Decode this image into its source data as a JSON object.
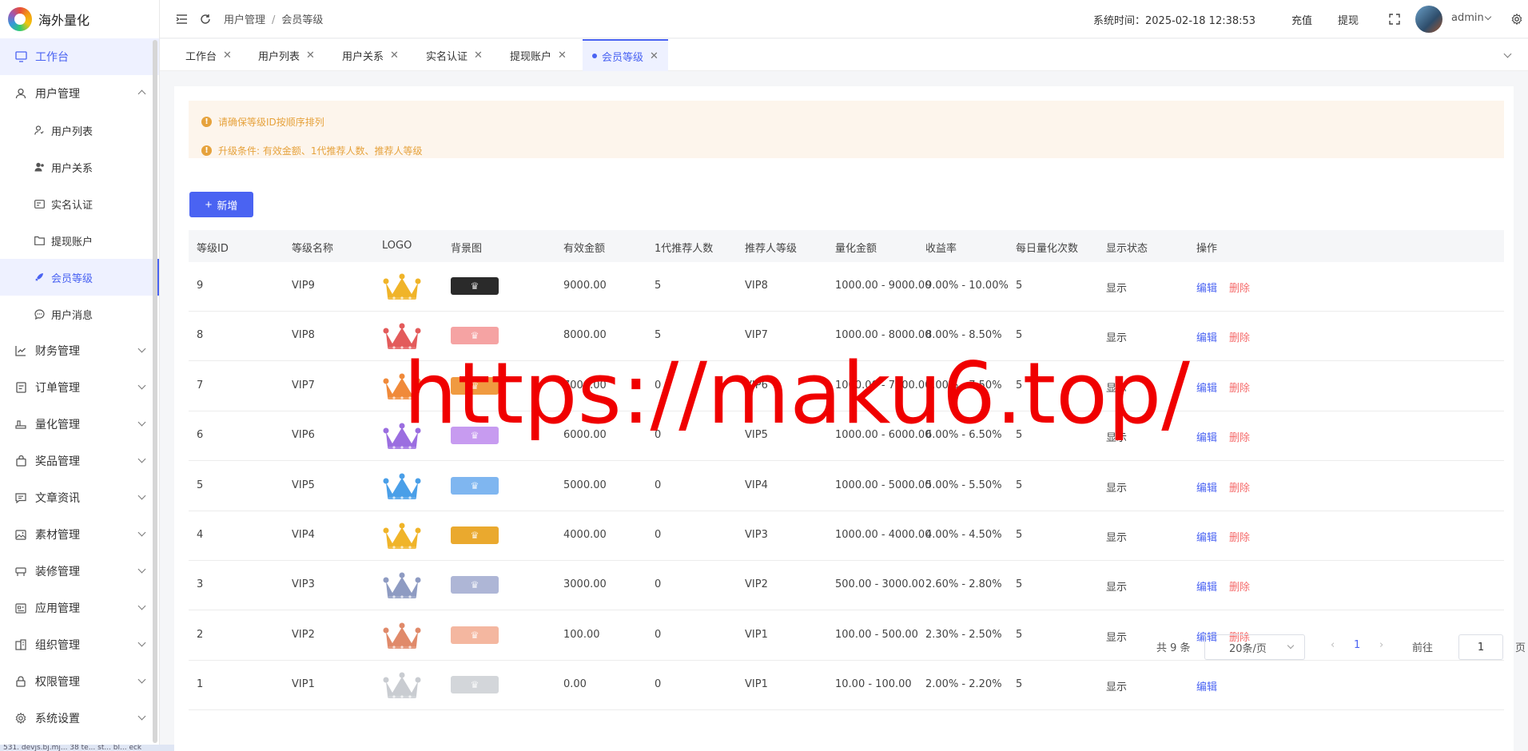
{
  "app": {
    "name": "海外量化"
  },
  "sidebar": {
    "workspace": "工作台",
    "user_mgmt": "用户管理",
    "sub": [
      {
        "label": "用户列表",
        "icon": "user-icon"
      },
      {
        "label": "用户关系",
        "icon": "users-icon"
      },
      {
        "label": "实名认证",
        "icon": "id-card-icon"
      },
      {
        "label": "提现账户",
        "icon": "folder-icon"
      },
      {
        "label": "会员等级",
        "icon": "rocket-icon"
      },
      {
        "label": "用户消息",
        "icon": "chat-icon"
      }
    ],
    "groups": [
      {
        "label": "财务管理",
        "icon": "chart-icon"
      },
      {
        "label": "订单管理",
        "icon": "order-icon"
      },
      {
        "label": "量化管理",
        "icon": "quant-icon"
      },
      {
        "label": "奖品管理",
        "icon": "bag-icon"
      },
      {
        "label": "文章资讯",
        "icon": "message-icon"
      },
      {
        "label": "素材管理",
        "icon": "image-icon"
      },
      {
        "label": "装修管理",
        "icon": "decor-icon"
      },
      {
        "label": "应用管理",
        "icon": "app-icon"
      },
      {
        "label": "组织管理",
        "icon": "org-icon"
      },
      {
        "label": "权限管理",
        "icon": "lock-icon"
      },
      {
        "label": "系统设置",
        "icon": "gear-icon"
      }
    ],
    "bottom_text": "531. devjs.bj.mj... 38 te... st... bl... eck"
  },
  "header": {
    "breadcrumb": [
      "用户管理",
      "会员等级"
    ],
    "system_time": "系统时间：2025-02-18 12:38:53",
    "recharge": "充值",
    "withdraw": "提现",
    "user": "admin"
  },
  "tabs": [
    "工作台",
    "用户列表",
    "用户关系",
    "实名认证",
    "提现账户",
    "会员等级"
  ],
  "alerts": [
    "请确保等级ID按顺序排列",
    "升级条件: 有效金额、1代推荐人数、推荐人等级"
  ],
  "add_button": "新增",
  "table": {
    "headers": [
      "等级ID",
      "等级名称",
      "LOGO",
      "背景图",
      "有效金额",
      "1代推荐人数",
      "推荐人等级",
      "量化金额",
      "收益率",
      "每日量化次数",
      "显示状态",
      "操作"
    ],
    "rows": [
      {
        "id": "9",
        "name": "VIP9",
        "amount": "9000.00",
        "refs": "5",
        "ref_level": "VIP8",
        "quant": "1000.00 - 9000.00",
        "rate": "9.00% - 10.00%",
        "daily": "5",
        "status": "显示",
        "edit": "编辑",
        "del": "删除",
        "crown_color": "#f0b429",
        "bg_color": "#2a2a2a"
      },
      {
        "id": "8",
        "name": "VIP8",
        "amount": "8000.00",
        "refs": "5",
        "ref_level": "VIP7",
        "quant": "1000.00 - 8000.00",
        "rate": "8.00% - 8.50%",
        "daily": "5",
        "status": "显示",
        "edit": "编辑",
        "del": "删除",
        "crown_color": "#e35b5b",
        "bg_color": "#f5a3a3"
      },
      {
        "id": "7",
        "name": "VIP7",
        "amount": "7000.00",
        "refs": "0",
        "ref_level": "VIP6",
        "quant": "1000.00 - 7000.00",
        "rate": "7.00% - 7.50%",
        "daily": "5",
        "status": "显示",
        "edit": "编辑",
        "del": "删除",
        "crown_color": "#f08a3a",
        "bg_color": "#f09a40"
      },
      {
        "id": "6",
        "name": "VIP6",
        "amount": "6000.00",
        "refs": "0",
        "ref_level": "VIP5",
        "quant": "1000.00 - 6000.00",
        "rate": "6.00% - 6.50%",
        "daily": "5",
        "status": "显示",
        "edit": "编辑",
        "del": "删除",
        "crown_color": "#9b6ee0",
        "bg_color": "#c79bf0"
      },
      {
        "id": "5",
        "name": "VIP5",
        "amount": "5000.00",
        "refs": "0",
        "ref_level": "VIP4",
        "quant": "1000.00 - 5000.00",
        "rate": "5.00% - 5.50%",
        "daily": "5",
        "status": "显示",
        "edit": "编辑",
        "del": "删除",
        "crown_color": "#4a9fe8",
        "bg_color": "#7fb6f0"
      },
      {
        "id": "4",
        "name": "VIP4",
        "amount": "4000.00",
        "refs": "0",
        "ref_level": "VIP3",
        "quant": "1000.00 - 4000.00",
        "rate": "4.00% - 4.50%",
        "daily": "5",
        "status": "显示",
        "edit": "编辑",
        "del": "删除",
        "crown_color": "#f0b429",
        "bg_color": "#eaa92e"
      },
      {
        "id": "3",
        "name": "VIP3",
        "amount": "3000.00",
        "refs": "0",
        "ref_level": "VIP2",
        "quant": "500.00 - 3000.00",
        "rate": "2.60% - 2.80%",
        "daily": "5",
        "status": "显示",
        "edit": "编辑",
        "del": "删除",
        "crown_color": "#8e9bc2",
        "bg_color": "#aeb6d6"
      },
      {
        "id": "2",
        "name": "VIP2",
        "amount": "100.00",
        "refs": "0",
        "ref_level": "VIP1",
        "quant": "100.00 - 500.00",
        "rate": "2.30% - 2.50%",
        "daily": "5",
        "status": "显示",
        "edit": "编辑",
        "del": "删除",
        "crown_color": "#e08a6a",
        "bg_color": "#f4b7a0"
      },
      {
        "id": "1",
        "name": "VIP1",
        "amount": "0.00",
        "refs": "0",
        "ref_level": "VIP1",
        "quant": "10.00 - 100.00",
        "rate": "2.00% - 2.20%",
        "daily": "5",
        "status": "显示",
        "edit": "编辑",
        "del": "",
        "crown_color": "#c9ccd1",
        "bg_color": "#d3d6da"
      }
    ]
  },
  "pagination": {
    "total": "共 9 条",
    "page_size": "20条/页",
    "current": "1",
    "goto_label": "前往",
    "goto_value": "1",
    "page_unit": "页"
  },
  "watermark": "https://maku6.top/",
  "colors": {
    "accent": "#4a63f2",
    "danger": "#f56c6c",
    "warning": "#e6a23c"
  }
}
